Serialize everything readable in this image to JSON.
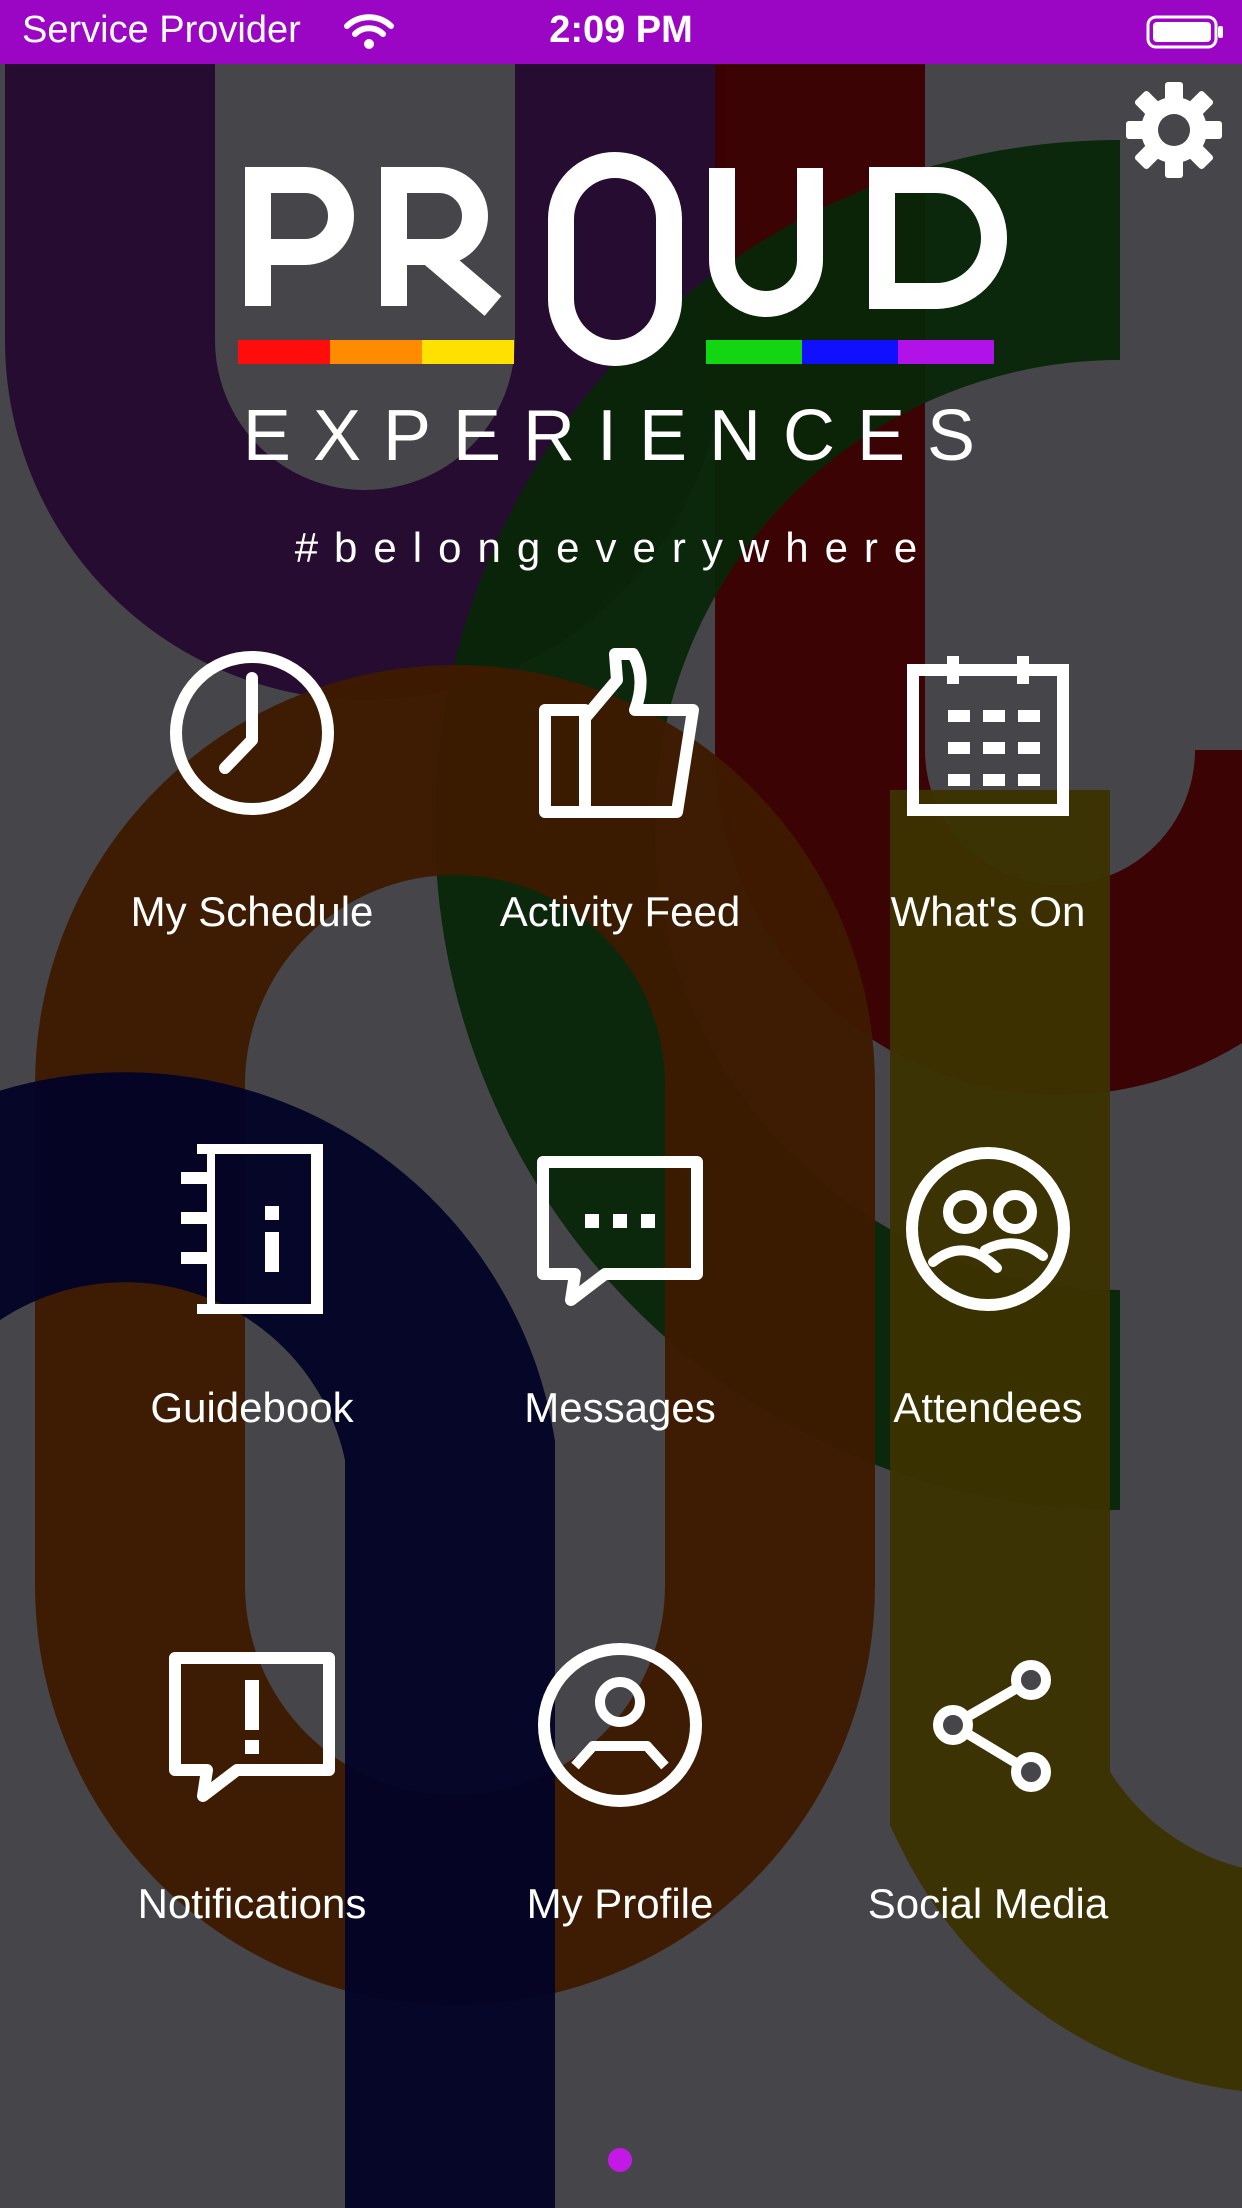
{
  "status_bar": {
    "carrier": "Service Provider",
    "time": "2:09 PM"
  },
  "brand": {
    "logo_text": "PROUD EXPERIENCES",
    "hashtag": "#belongeverywhere",
    "rainbow": [
      "#ff0d0d",
      "#ff8c00",
      "#ffe100",
      "#11d611",
      "#1010ff",
      "#b012e8"
    ]
  },
  "colors": {
    "status_bar": "#9b06c4",
    "page_indicator": "#c318e6",
    "background": "#46464a"
  },
  "menu": [
    {
      "label": "My Schedule",
      "icon": "clock-icon"
    },
    {
      "label": "Activity Feed",
      "icon": "thumbs-up-icon"
    },
    {
      "label": "What's On",
      "icon": "calendar-icon"
    },
    {
      "label": "Guidebook",
      "icon": "guidebook-icon"
    },
    {
      "label": "Messages",
      "icon": "chat-bubble-icon"
    },
    {
      "label": "Attendees",
      "icon": "people-icon"
    },
    {
      "label": "Notifications",
      "icon": "alert-bubble-icon"
    },
    {
      "label": "My Profile",
      "icon": "user-circle-icon"
    },
    {
      "label": "Social Media",
      "icon": "share-icon"
    }
  ],
  "settings_icon": "gear-icon"
}
